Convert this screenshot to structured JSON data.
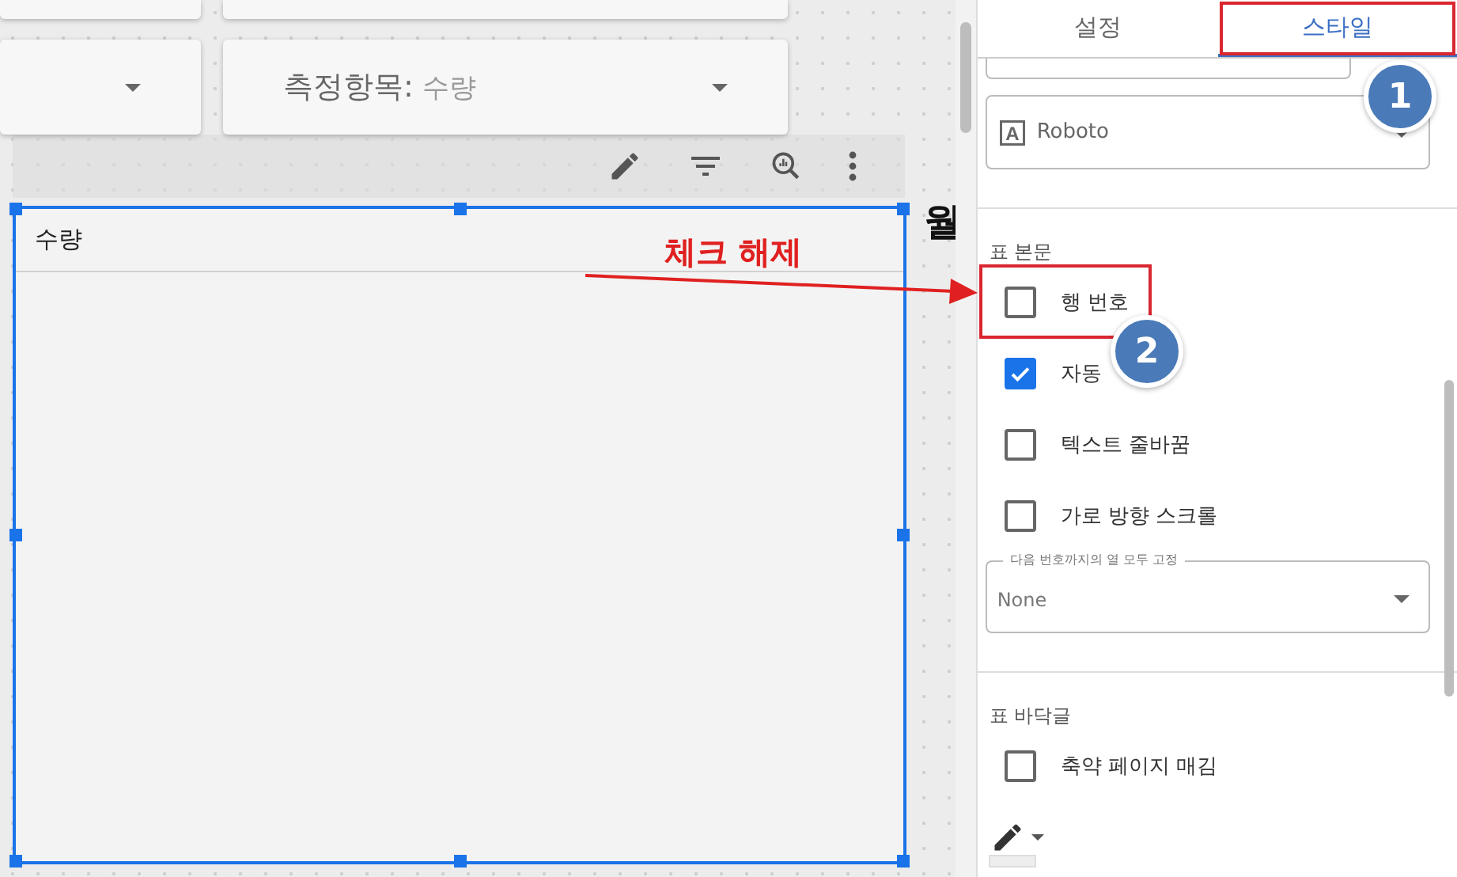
{
  "metric_control": {
    "label": "측정항목:",
    "value": "수량"
  },
  "table": {
    "header": "수량"
  },
  "side_label": "월",
  "panel": {
    "tabs": [
      {
        "label": "설정",
        "selected": false
      },
      {
        "label": "스타일",
        "selected": true,
        "highlighted": true
      }
    ],
    "font": {
      "icon_letter": "A",
      "value": "Roboto"
    },
    "sections": [
      {
        "title": "표 본문",
        "items": [
          {
            "kind": "checkbox",
            "label": "행 번호",
            "checked": false,
            "highlighted": true
          },
          {
            "kind": "checkbox",
            "label": "자동",
            "checked": true
          },
          {
            "kind": "checkbox",
            "label": "텍스트 줄바꿈",
            "checked": false
          },
          {
            "kind": "checkbox",
            "label": "가로 방향 스크롤",
            "checked": false
          },
          {
            "kind": "select",
            "legend": "다음 번호까지의 열 모두 고정",
            "value": "None"
          }
        ]
      },
      {
        "title": "표 바닥글",
        "items": [
          {
            "kind": "checkbox",
            "label": "축약 페이지 매김",
            "checked": false
          }
        ]
      }
    ]
  },
  "annotations": {
    "note": "체크 해제",
    "badges": [
      "1",
      "2"
    ]
  }
}
